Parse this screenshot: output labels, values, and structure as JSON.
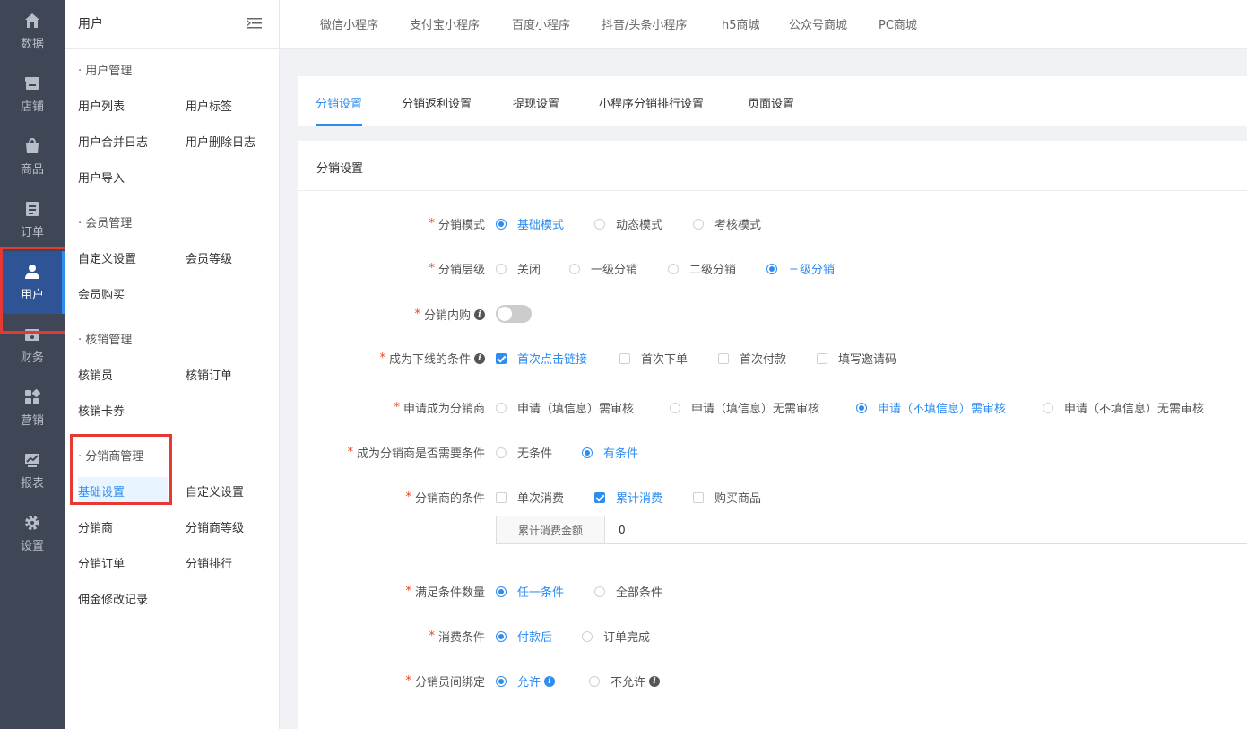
{
  "rail": {
    "items": [
      {
        "label": "数据",
        "icon": "home-icon"
      },
      {
        "label": "店铺",
        "icon": "store-icon"
      },
      {
        "label": "商品",
        "icon": "shopping-bag-icon"
      },
      {
        "label": "订单",
        "icon": "order-document-icon"
      },
      {
        "label": "用户",
        "icon": "user-icon",
        "active": true
      },
      {
        "label": "财务",
        "icon": "finance-icon"
      },
      {
        "label": "营销",
        "icon": "marketing-grid-icon"
      },
      {
        "label": "报表",
        "icon": "chart-icon"
      },
      {
        "label": "设置",
        "icon": "gear-icon"
      }
    ]
  },
  "menu": {
    "title": "用户",
    "groups": [
      {
        "title": "· 用户管理",
        "links": [
          "用户列表",
          "用户标签",
          "用户合并日志",
          "用户删除日志",
          "用户导入"
        ]
      },
      {
        "title": "· 会员管理",
        "links": [
          "自定义设置",
          "会员等级",
          "会员购买"
        ]
      },
      {
        "title": "· 核销管理",
        "links": [
          "核销员",
          "核销订单",
          "核销卡券"
        ]
      },
      {
        "title": "· 分销商管理",
        "links": [
          "基础设置",
          "自定义设置",
          "分销商",
          "分销商等级",
          "分销订单",
          "分销排行",
          "佣金修改记录"
        ]
      }
    ],
    "active_link": "基础设置"
  },
  "topnav": {
    "tabs": [
      "微信小程序",
      "支付宝小程序",
      "百度小程序",
      "抖音/头条小程序",
      "h5商城",
      "公众号商城",
      "PC商城"
    ]
  },
  "subtabs": {
    "tabs": [
      "分销设置",
      "分销返利设置",
      "提现设置",
      "小程序分销排行设置",
      "页面设置"
    ],
    "active": "分销设置"
  },
  "form": {
    "title": "分销设置",
    "rows": {
      "mode": {
        "label": "分销模式",
        "options": [
          "基础模式",
          "动态模式",
          "考核模式"
        ],
        "selected": "基础模式"
      },
      "level": {
        "label": "分销层级",
        "options": [
          "关闭",
          "一级分销",
          "二级分销",
          "三级分销"
        ],
        "selected": "三级分销"
      },
      "internal": {
        "label": "分销内购",
        "enabled": false
      },
      "downline": {
        "label": "成为下线的条件",
        "options": [
          "首次点击链接",
          "首次下单",
          "首次付款",
          "填写邀请码"
        ],
        "checked": [
          "首次点击链接"
        ]
      },
      "apply": {
        "label": "申请成为分销商",
        "options": [
          "申请（填信息）需审核",
          "申请（填信息）无需审核",
          "申请（不填信息）需审核",
          "申请（不填信息）无需审核"
        ],
        "selected": "申请（不填信息）需审核"
      },
      "need_condition": {
        "label": "成为分销商是否需要条件",
        "options": [
          "无条件",
          "有条件"
        ],
        "selected": "有条件"
      },
      "conditions": {
        "label": "分销商的条件",
        "options": [
          "单次消费",
          "累计消费",
          "购买商品"
        ],
        "checked": [
          "累计消费"
        ]
      },
      "amount": {
        "prepend": "累计消费金额",
        "value": "0"
      },
      "count": {
        "label": "满足条件数量",
        "options": [
          "任一条件",
          "全部条件"
        ],
        "selected": "任一条件"
      },
      "consume": {
        "label": "消费条件",
        "options": [
          "付款后",
          "订单完成"
        ],
        "selected": "付款后"
      },
      "bind": {
        "label": "分销员间绑定",
        "options": [
          "允许",
          "不允许"
        ],
        "selected": "允许"
      }
    },
    "required_mark": "*",
    "info_glyph": "i"
  },
  "colors": {
    "accent": "#2d8cf0",
    "rail_bg": "#3f4757",
    "highlight_box": "#e53935"
  }
}
